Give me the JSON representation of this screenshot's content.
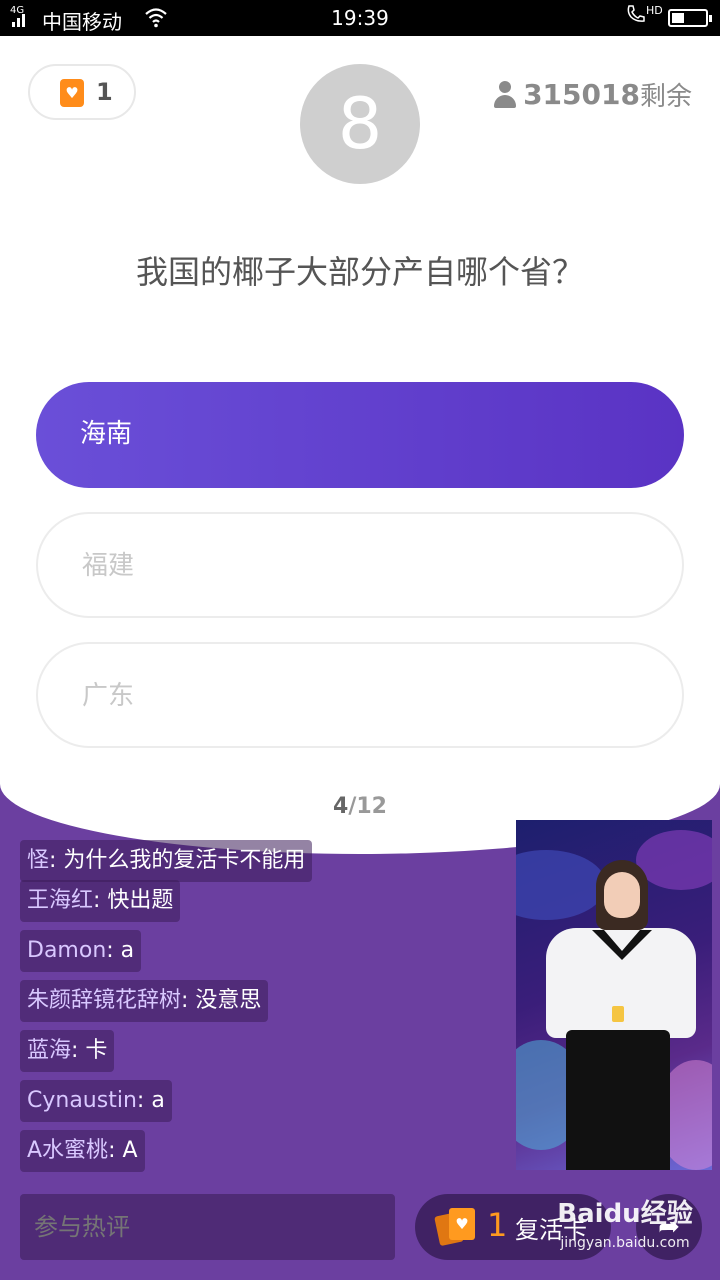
{
  "status_bar": {
    "network_type": "4G",
    "carrier": "中国移动",
    "time": "19:39",
    "hd_label": "HD"
  },
  "header": {
    "lives_count": "1",
    "timer_value": "8",
    "remaining_count": "315018",
    "remaining_label": "剩余",
    "icons": {
      "heart_card": "heart-card-icon",
      "user": "user-icon"
    }
  },
  "question": {
    "text": "我国的椰子大部分产自哪个省？"
  },
  "options": [
    {
      "label": "海南",
      "selected": true
    },
    {
      "label": "福建",
      "selected": false
    },
    {
      "label": "广东",
      "selected": false
    }
  ],
  "progress": {
    "current": "4",
    "separator": "/",
    "total": "12"
  },
  "comments": [
    {
      "user": "怪",
      "message": "为什么我的复活卡不能用"
    },
    {
      "user": "王海红",
      "message": "快出题"
    },
    {
      "user": "Damon",
      "message": "a"
    },
    {
      "user": "朱颜辞镜花辞树",
      "message": "没意思"
    },
    {
      "user": "蓝海",
      "message": "卡"
    },
    {
      "user": "Cynaustin",
      "message": "a"
    },
    {
      "user": "A水蜜桃",
      "message": "A"
    }
  ],
  "bottom_bar": {
    "comment_placeholder": "参与热评",
    "revive_count": "1",
    "revive_label": "复活卡"
  },
  "watermark": {
    "logo": "Baidu经验",
    "url": "jingyan.baidu.com"
  },
  "colors": {
    "background": "#6b3fa0",
    "selected_option": "#5a33c4",
    "accent_orange": "#ff9a1f",
    "timer_circle": "#cfcfcf"
  }
}
